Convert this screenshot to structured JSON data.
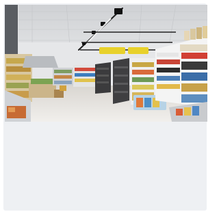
{
  "image": {
    "alt": ""
  },
  "colors": {
    "panel_bg": "#eef0f3",
    "ceiling": "#dcdcdc",
    "floor": "#e9e6e2",
    "track_light": "#1f1f1f",
    "sign_yellow": "#e8d12b",
    "shelf_dark": "#3b3b3d",
    "shelf_white": "#f2f2f2"
  }
}
